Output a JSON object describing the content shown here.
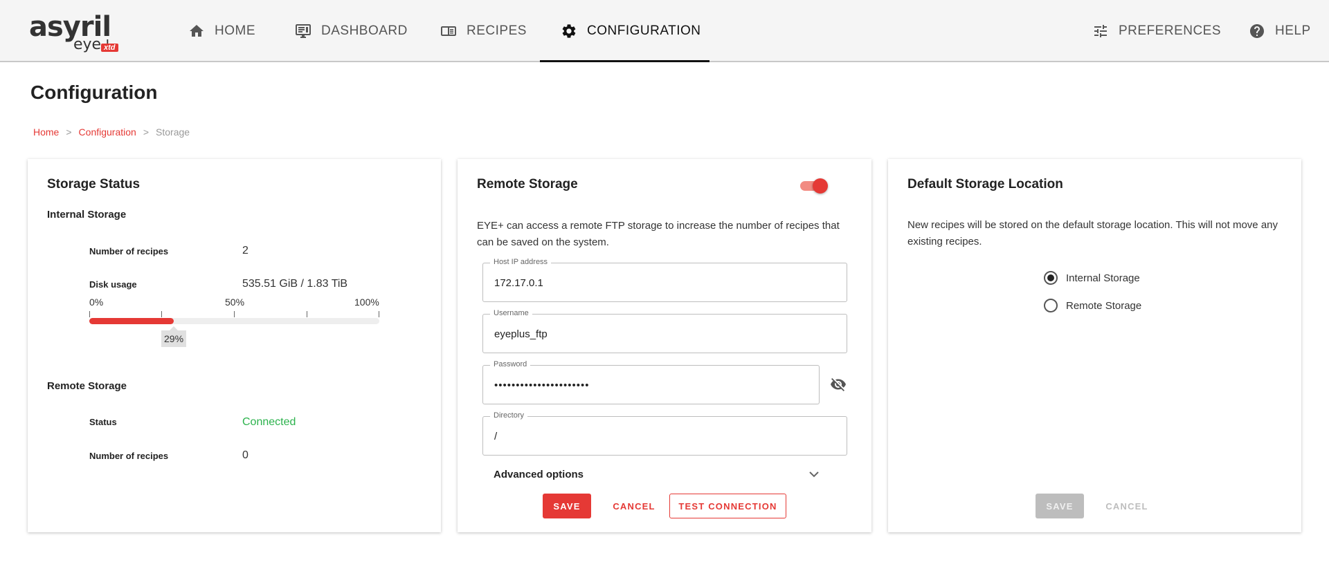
{
  "header": {
    "logo": {
      "brand": "asyril",
      "sub": "eye+",
      "badge": "xtd"
    },
    "nav": {
      "home": "HOME",
      "dashboard": "DASHBOARD",
      "recipes": "RECIPES",
      "configuration": "CONFIGURATION",
      "preferences": "PREFERENCES",
      "help": "HELP"
    },
    "active_tab": "CONFIGURATION"
  },
  "page": {
    "title": "Configuration",
    "breadcrumb": [
      "Home",
      "Configuration",
      "Storage"
    ],
    "breadcrumb_separator": ">"
  },
  "storage_status": {
    "title": "Storage Status",
    "internal": {
      "label": "Internal Storage",
      "recipes_label": "Number of recipes",
      "recipes_value": "2",
      "disk_label": "Disk usage",
      "disk_value": "535.51 GiB / 1.83 TiB",
      "scale": [
        "0%",
        "50%",
        "100%"
      ],
      "usage_percent": 29,
      "usage_label": "29%"
    },
    "remote": {
      "label": "Remote Storage",
      "status_label": "Status",
      "status_value": "Connected",
      "recipes_label": "Number of recipes",
      "recipes_value": "0"
    }
  },
  "remote_storage": {
    "title": "Remote Storage",
    "enabled": true,
    "description": "EYE+ can access a remote FTP storage to increase the number of recipes that can be saved on the system.",
    "host": {
      "label": "Host IP address",
      "value": "172.17.0.1"
    },
    "username": {
      "label": "Username",
      "value": "eyeplus_ftp"
    },
    "password": {
      "label": "Password",
      "value": "••••••••••••••••••••••"
    },
    "directory": {
      "label": "Directory",
      "value": "/"
    },
    "advanced_label": "Advanced options",
    "save": "SAVE",
    "cancel": "CANCEL",
    "test": "TEST CONNECTION"
  },
  "default_storage": {
    "title": "Default Storage Location",
    "description": "New recipes will be stored on the default storage location. This will not move any existing recipes.",
    "options": [
      "Internal Storage",
      "Remote Storage"
    ],
    "selected": "Internal Storage",
    "save": "SAVE",
    "cancel": "CANCEL"
  },
  "colors": {
    "accent": "#e53935",
    "success": "#2bb24c",
    "header_bg": "#f5f5f5"
  }
}
